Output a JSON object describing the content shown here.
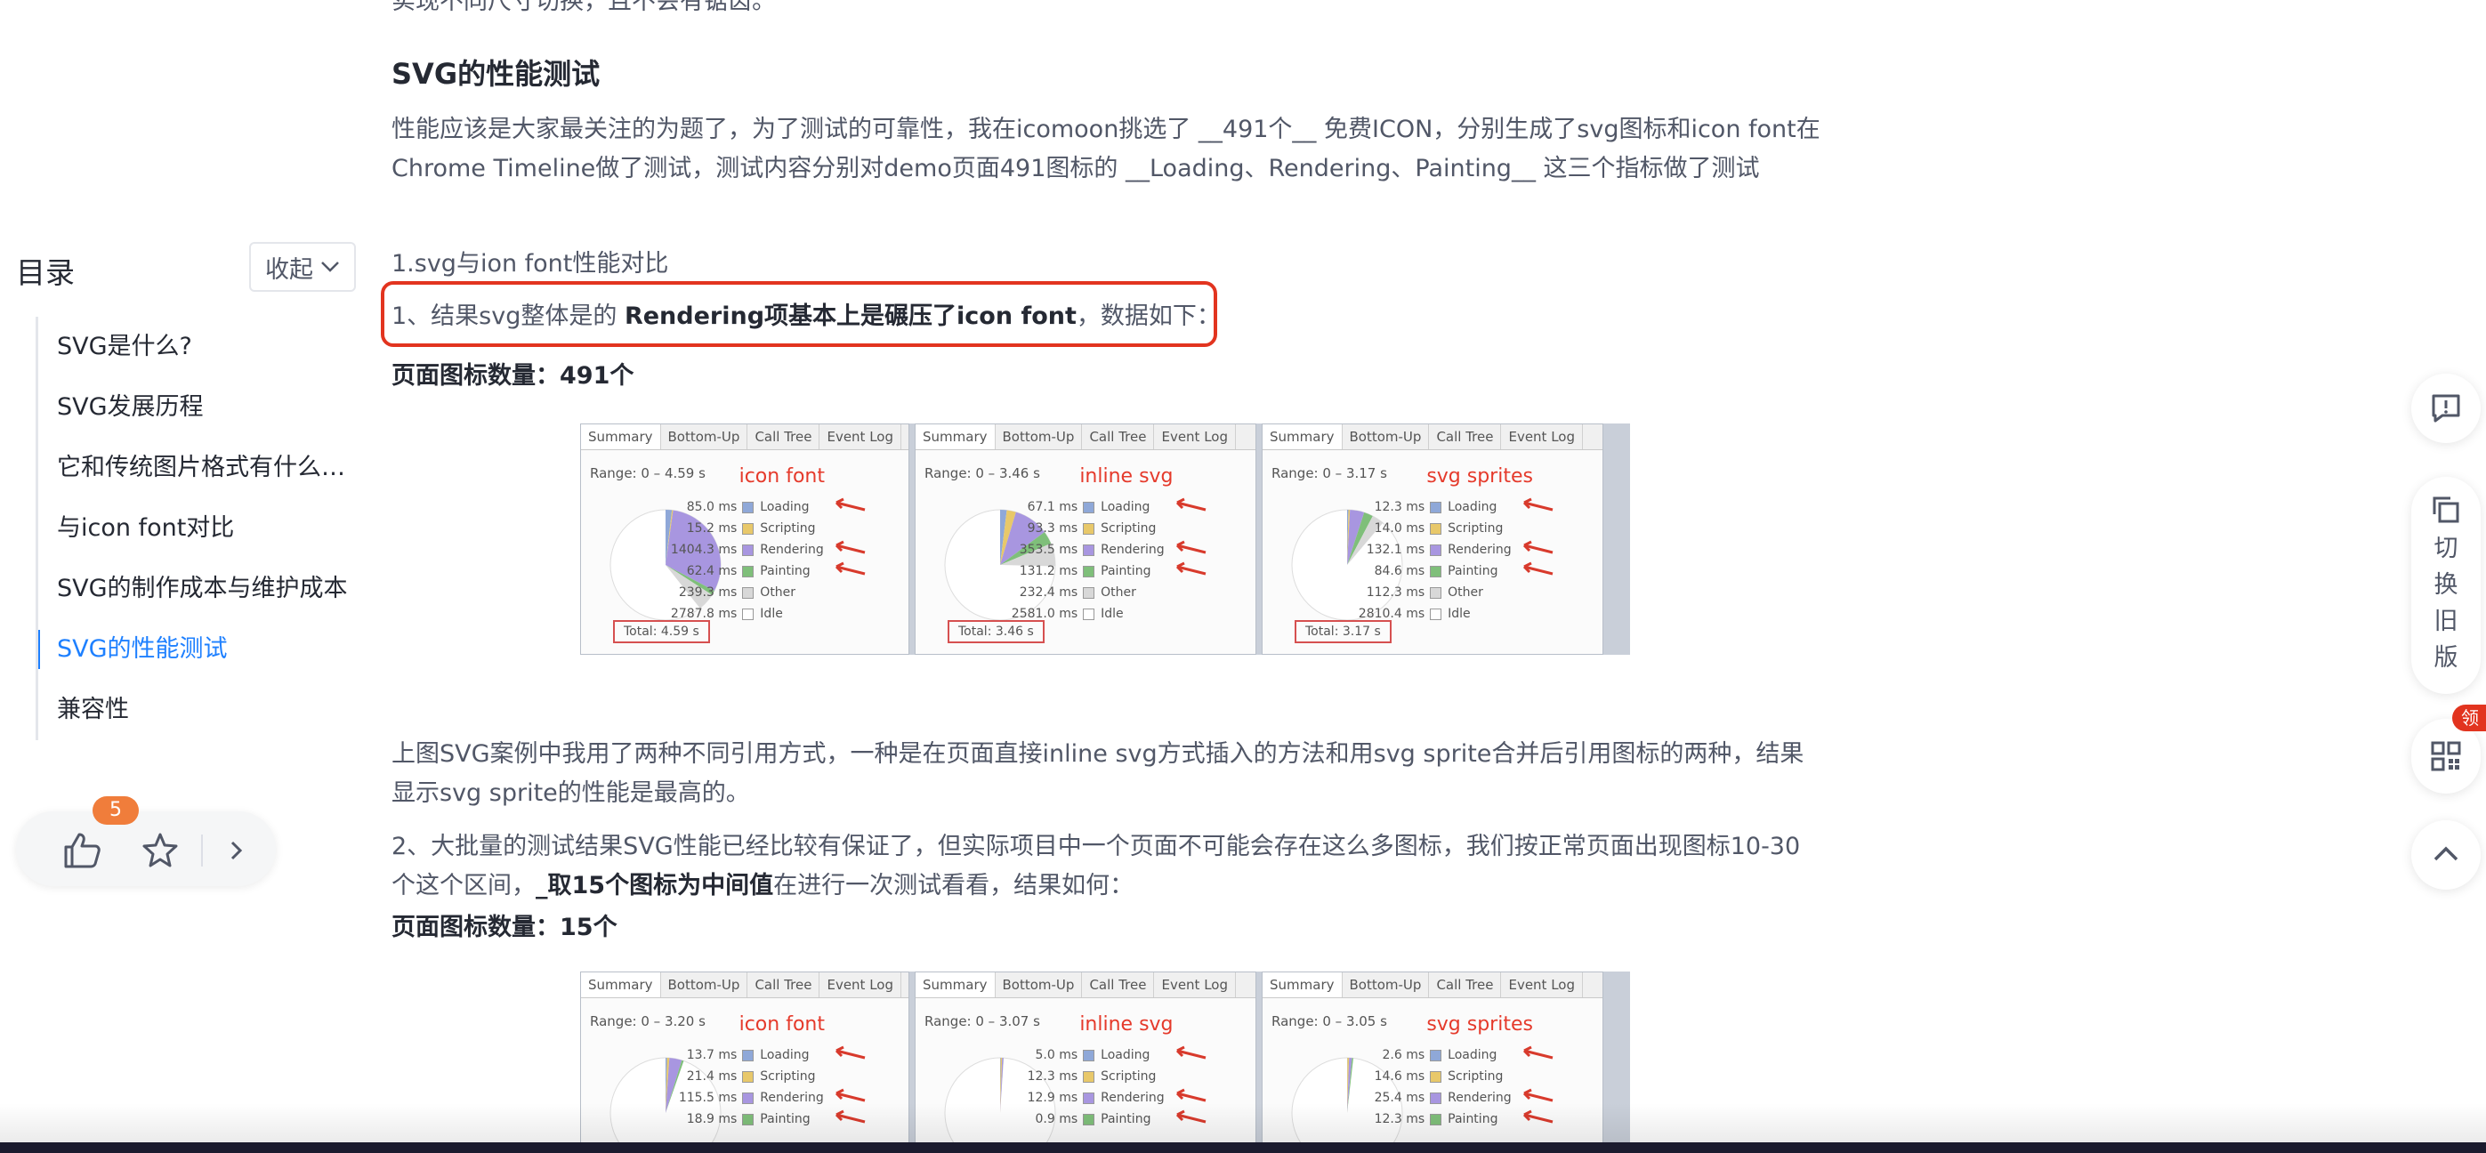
{
  "article": {
    "cut_line": "实现不同尺寸切换，且不会有锯齿。",
    "heading": "SVG的性能测试",
    "intro": "性能应该是大家最关注的为题了，为了测试的可靠性，我在icomoon挑选了 __491个__ 免费ICON，分别生成了svg图标和icon font在Chrome Timeline做了测试，测试内容分别对demo页面491图标的 __Loading、Rendering、Painting__ 这三个指标做了测试",
    "sub1": "1.svg与ion font性能对比",
    "result1_pre": "1、结果svg整体是的 ",
    "result1_bold": "Rendering项基本上是碾压了icon font",
    "result1_post": "，数据如下：",
    "count1": "页面图标数量：491个",
    "para2": "上图SVG案例中我用了两种不同引用方式，一种是在页面直接inline svg方式插入的方法和用svg sprite合并后引用图标的两种，结果显示svg sprite的性能是最高的。",
    "para3_pre": "2、大批量的测试结果SVG性能已经比较有保证了，但实际项目中一个页面不可能会存在这么多图标，我们按正常页面出现图标10-30个这个区间，",
    "para3_bold": "_取15个图标为中间值",
    "para3_post": "在进行一次测试看看，结果如何：",
    "count2": "页面图标数量：15个"
  },
  "perf_tabs": [
    "Summary",
    "Bottom-Up",
    "Call Tree",
    "Event Log"
  ],
  "legend_labels": [
    "Loading",
    "Scripting",
    "Rendering",
    "Painting",
    "Other",
    "Idle"
  ],
  "legend_colors": [
    "#8fa8d8",
    "#e8c86a",
    "#a896e0",
    "#7fbf7a",
    "#d8d8d8",
    "#ffffff"
  ],
  "perf1": [
    {
      "title": "icon font",
      "range": "Range: 0 – 4.59 s",
      "total": "Total: 4.59 s",
      "ms": [
        "85.0 ms",
        "15.2 ms",
        "1404.3 ms",
        "62.4 ms",
        "239.3 ms",
        "2787.8 ms"
      ]
    },
    {
      "title": "inline svg",
      "range": "Range: 0 – 3.46 s",
      "total": "Total: 3.46 s",
      "ms": [
        "67.1 ms",
        "93.3 ms",
        "353.5 ms",
        "131.2 ms",
        "232.4 ms",
        "2581.0 ms"
      ]
    },
    {
      "title": "svg sprites",
      "range": "Range: 0 – 3.17 s",
      "total": "Total: 3.17 s",
      "ms": [
        "12.3 ms",
        "14.0 ms",
        "132.1 ms",
        "84.6 ms",
        "112.3 ms",
        "2810.4 ms"
      ]
    }
  ],
  "perf2": [
    {
      "title": "icon font",
      "range": "Range: 0 – 3.20 s",
      "ms": [
        "13.7 ms",
        "21.4 ms",
        "115.5 ms",
        "18.9 ms"
      ]
    },
    {
      "title": "inline svg",
      "range": "Range: 0 – 3.07 s",
      "ms": [
        "5.0 ms",
        "12.3 ms",
        "12.9 ms",
        "0.9 ms"
      ]
    },
    {
      "title": "svg sprites",
      "range": "Range: 0 – 3.05 s",
      "ms": [
        "2.6 ms",
        "14.6 ms",
        "25.4 ms",
        "12.3 ms"
      ]
    }
  ],
  "toc": {
    "title": "目录",
    "collapse": "收起",
    "items": [
      "SVG是什么?",
      "SVG发展历程",
      "它和传统图片格式有什么区别",
      "与icon font对比",
      "SVG的制作成本与维护成本",
      "SVG的性能测试",
      "兼容性"
    ]
  },
  "actions": {
    "like_count": "5"
  },
  "right": {
    "switch_label": [
      "切",
      "换",
      "旧",
      "版"
    ],
    "badge": "领"
  },
  "colors": {
    "accent": "#1e80ff",
    "highlight": "#e2341f",
    "badge": "#f07d3b"
  }
}
